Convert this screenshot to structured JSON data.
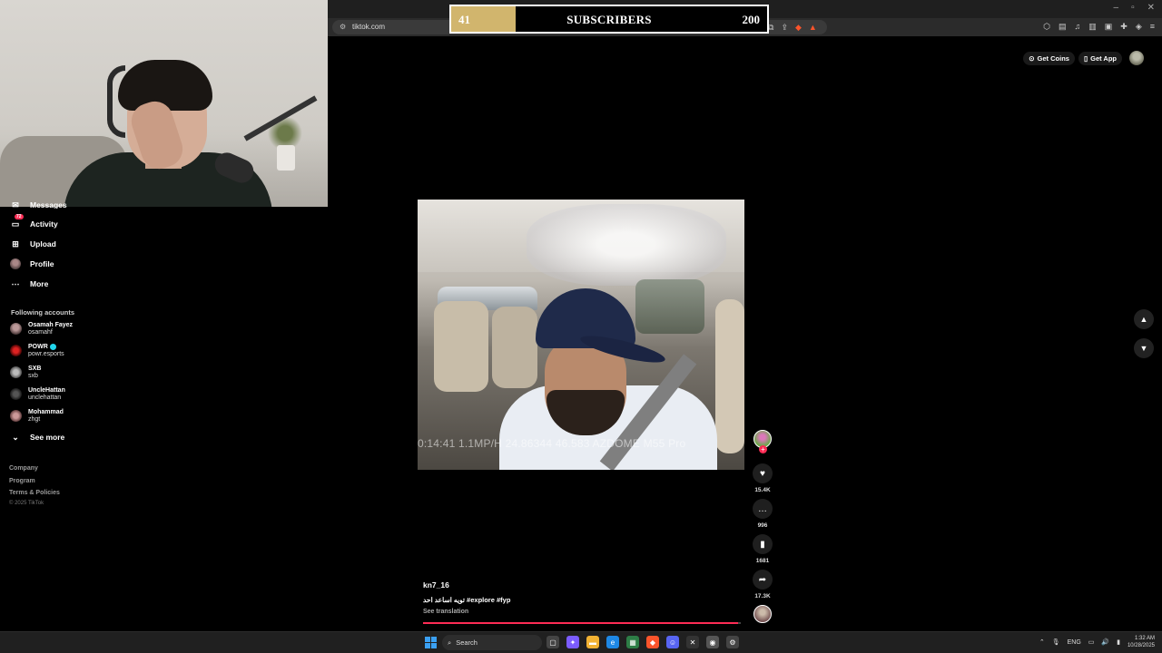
{
  "browser": {
    "url": "tiktok.com",
    "window_controls": [
      "–",
      "▫",
      "✕"
    ]
  },
  "overlay": {
    "current": "41",
    "label": "SUBSCRIBERS",
    "goal": "200",
    "progress": 0.205,
    "fill_color": "#d1b56d"
  },
  "sidebar": {
    "messages_label": "Messages",
    "activity_label": "Activity",
    "activity_badge": "72",
    "upload_label": "Upload",
    "profile_label": "Profile",
    "more_label": "More",
    "following_title": "Following accounts",
    "accounts": [
      {
        "name": "Osamah Fayez",
        "handle": "osamahf"
      },
      {
        "name": "POWR",
        "handle": "powr.esports",
        "verified": true
      },
      {
        "name": "SXB",
        "handle": "sxb"
      },
      {
        "name": "UncleHattan",
        "handle": "unclehattan"
      },
      {
        "name": "Mohammad",
        "handle": "zhgt"
      }
    ],
    "see_more_label": "See more",
    "footer": [
      "Company",
      "Program",
      "Terms & Policies"
    ],
    "copyright": "© 2025 TikTok"
  },
  "top_actions": {
    "coins_label": "Get Coins",
    "app_label": "Get App"
  },
  "video": {
    "overlay_text": "0:14:41  1.1MP/H 24.86344  46.583  AZDOME M55 Pro"
  },
  "rail": {
    "likes": "15.4K",
    "comments": "996",
    "saves": "1681",
    "shares": "17.3K"
  },
  "post": {
    "author": "kn7_16",
    "caption": "تويه اساعد احد #explore #fyp",
    "see_translation": "See translation",
    "progress": 0.99,
    "accent": "#fe2c55"
  },
  "taskbar": {
    "search_label": "Search",
    "lang": "ENG",
    "time": "1:32 AM",
    "date": "10/28/2025"
  }
}
